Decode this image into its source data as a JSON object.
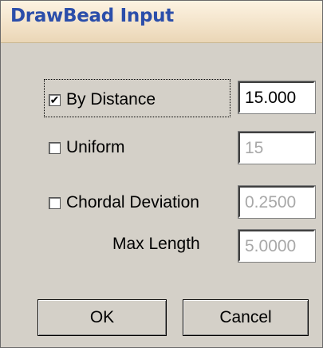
{
  "dialog": {
    "title": "DrawBead Input"
  },
  "options": {
    "by_distance": {
      "label": "By Distance",
      "checked": true,
      "check_mark": "✔",
      "value": "15.000"
    },
    "uniform": {
      "label": "Uniform",
      "checked": false,
      "check_mark": "",
      "value": "15"
    },
    "chordal_deviation": {
      "label": "Chordal Deviation",
      "checked": false,
      "check_mark": "",
      "value": "0.2500"
    },
    "max_length": {
      "label": "Max Length",
      "value": "5.0000"
    }
  },
  "buttons": {
    "ok_label": "OK",
    "cancel_label": "Cancel"
  }
}
